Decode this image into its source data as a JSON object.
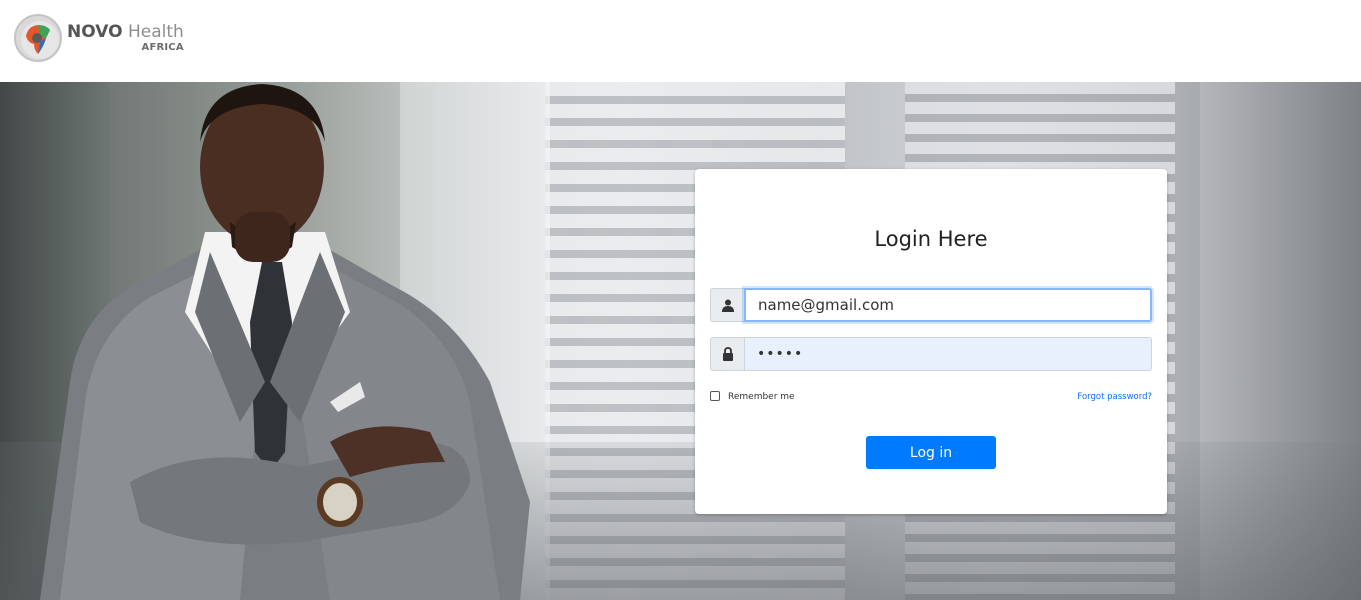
{
  "header": {
    "logo_brand": "NOVO",
    "logo_product": "Health",
    "logo_region": "AFRICA"
  },
  "login": {
    "title": "Login Here",
    "username_value": "name@gmail.com",
    "password_value": "•••••",
    "remember_label": "Remember me",
    "remember_checked": false,
    "forgot_label": "Forgot password?",
    "submit_label": "Log in"
  },
  "icons": {
    "logo": "africa-globe-logo-icon",
    "username": "user-icon",
    "password": "lock-icon"
  },
  "colors": {
    "primary": "#007bff",
    "link": "#0d6efd",
    "focus_border": "#86b7fe",
    "autofill_bg": "#e8f0fe"
  }
}
